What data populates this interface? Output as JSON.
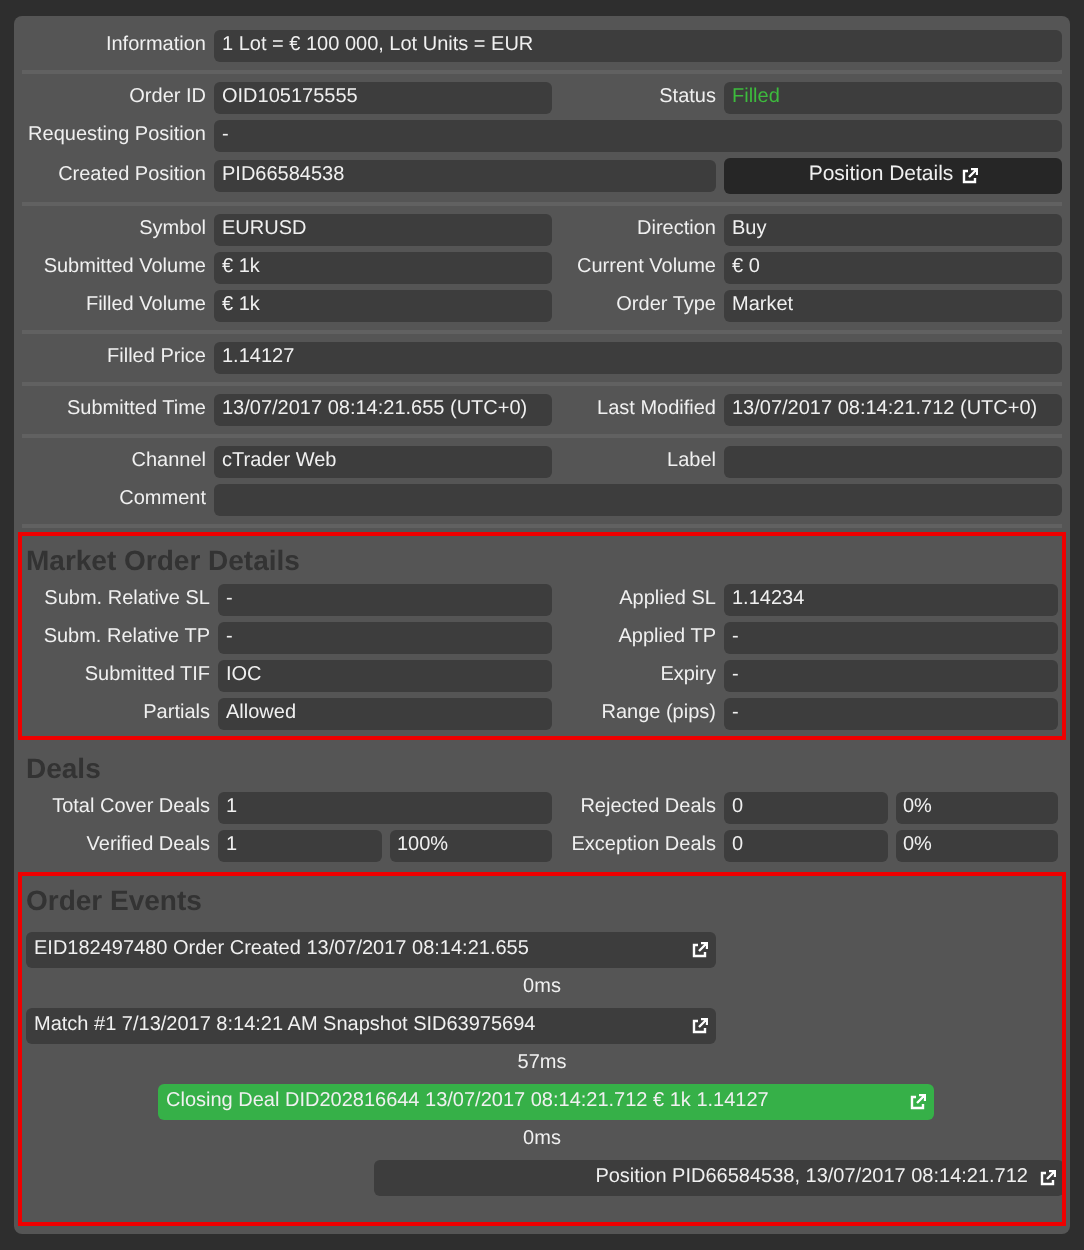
{
  "sections": [
    {
      "groups": [
        [
          {
            "kind": "full",
            "fields": [
              {
                "label": "Information",
                "value": "1 Lot = € 100 000, Lot Units = EUR"
              }
            ]
          }
        ],
        [
          {
            "kind": "pair",
            "fields": [
              {
                "label": "Order ID",
                "value": "OID105175555"
              },
              {
                "label": "Status",
                "value": "Filled",
                "kind": "status"
              }
            ]
          },
          {
            "kind": "full",
            "fields": [
              {
                "label": "Requesting Position",
                "value": "-"
              }
            ]
          },
          {
            "kind": "button",
            "fields": [
              {
                "label": "Created Position",
                "value": "PID66584538"
              },
              {
                "kind": "button",
                "value": "Position Details"
              }
            ]
          }
        ],
        [
          {
            "kind": "pair",
            "fields": [
              {
                "label": "Symbol",
                "value": "EURUSD"
              },
              {
                "label": "Direction",
                "value": "Buy"
              }
            ]
          },
          {
            "kind": "pair",
            "fields": [
              {
                "label": "Submitted Volume",
                "value": "€ 1k"
              },
              {
                "label": "Current Volume",
                "value": "€ 0"
              }
            ]
          },
          {
            "kind": "pair",
            "fields": [
              {
                "label": "Filled Volume",
                "value": "€ 1k"
              },
              {
                "label": "Order Type",
                "value": "Market"
              }
            ]
          }
        ],
        [
          {
            "kind": "full",
            "fields": [
              {
                "label": "Filled Price",
                "value": "1.14127"
              }
            ]
          }
        ],
        [
          {
            "kind": "pair",
            "fields": [
              {
                "label": "Submitted Time",
                "value": "13/07/2017 08:14:21.655 (UTC+0)"
              },
              {
                "label": "Last Modified",
                "value": "13/07/2017 08:14:21.712 (UTC+0)"
              }
            ]
          }
        ],
        [
          {
            "kind": "pair",
            "fields": [
              {
                "label": "Channel",
                "value": "cTrader Web"
              },
              {
                "label": "Label"
              }
            ]
          },
          {
            "kind": "full",
            "fields": [
              {
                "label": "Comment"
              }
            ]
          }
        ]
      ]
    },
    {
      "title": "Market Order Details",
      "highlighted": true,
      "groups": [
        [
          {
            "kind": "pair",
            "fields": [
              {
                "label": "Subm. Relative SL",
                "value": "-"
              },
              {
                "label": "Applied SL",
                "value": "1.14234"
              }
            ]
          },
          {
            "kind": "pair",
            "fields": [
              {
                "label": "Subm. Relative TP",
                "value": "-"
              },
              {
                "label": "Applied TP",
                "value": "-"
              }
            ]
          },
          {
            "kind": "pair",
            "fields": [
              {
                "label": "Submitted TIF",
                "value": "IOC"
              },
              {
                "label": "Expiry",
                "value": "-"
              }
            ]
          },
          {
            "kind": "pair",
            "fields": [
              {
                "label": "Partials",
                "value": "Allowed"
              },
              {
                "label": "Range (pips)",
                "value": "-"
              }
            ]
          }
        ]
      ]
    },
    {
      "title": "Deals",
      "groups": [
        [
          {
            "kind": "pair",
            "fields": [
              {
                "label": "Total Cover Deals",
                "value": "1"
              },
              {
                "label": "Rejected Deals",
                "value": "0",
                "percent": "0%"
              }
            ]
          },
          {
            "kind": "pair",
            "fields": [
              {
                "label": "Verified Deals",
                "value": "1",
                "percent": "100%"
              },
              {
                "label": "Exception Deals",
                "value": "0",
                "percent": "0%"
              }
            ]
          }
        ]
      ]
    }
  ],
  "order_events": {
    "title": "Order Events",
    "highlighted": true,
    "items": [
      {
        "kind": "order",
        "text": "EID182497480 Order Created 13/07/2017 08:14:21.655"
      },
      {
        "kind": "gap",
        "text": "0ms"
      },
      {
        "kind": "order",
        "text": "Match #1 7/13/2017 8:14:21 AM Snapshot SID63975694"
      },
      {
        "kind": "gap",
        "text": "57ms"
      },
      {
        "kind": "deal",
        "text": "Closing Deal DID202816644 13/07/2017 08:14:21.712 € 1k 1.14127"
      },
      {
        "kind": "gap",
        "text": "0ms"
      },
      {
        "kind": "position",
        "text": "Position PID66584538, 13/07/2017 08:14:21.712"
      }
    ]
  }
}
